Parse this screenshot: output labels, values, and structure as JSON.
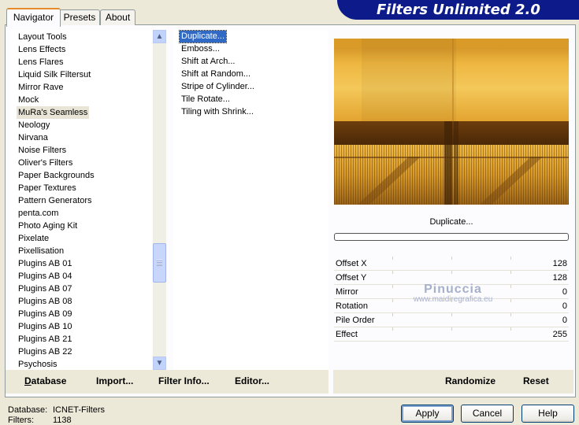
{
  "banner": {
    "title": "Filters Unlimited 2.0"
  },
  "tabs": [
    {
      "label": "Navigator",
      "active": true
    },
    {
      "label": "Presets",
      "active": false
    },
    {
      "label": "About",
      "active": false
    }
  ],
  "categories": [
    "Layout Tools",
    "Lens Effects",
    "Lens Flares",
    "Liquid Silk Filtersut",
    "Mirror Rave",
    "Mock",
    "MuRa's Seamless",
    "Neology",
    "Nirvana",
    "Noise Filters",
    "Oliver's Filters",
    "Paper Backgrounds",
    "Paper Textures",
    "Pattern Generators",
    "penta.com",
    "Photo Aging Kit",
    "Pixelate",
    "Pixellisation",
    "Plugins AB 01",
    "Plugins AB 04",
    "Plugins AB 07",
    "Plugins AB 08",
    "Plugins AB 09",
    "Plugins AB 10",
    "Plugins AB 21",
    "Plugins AB 22",
    "Psychosis"
  ],
  "selected_category": "MuRa's Seamless",
  "filters": [
    "Duplicate...",
    "Emboss...",
    "Shift at Arch...",
    "Shift at Random...",
    "Stripe of Cylinder...",
    "Tile Rotate...",
    "Tiling with Shrink..."
  ],
  "selected_filter": "Duplicate...",
  "current_filter_label": "Duplicate...",
  "progress": 0,
  "params": [
    {
      "label": "Offset X",
      "value": "128"
    },
    {
      "label": "Offset Y",
      "value": "128"
    },
    {
      "label": "Mirror",
      "value": "0"
    },
    {
      "label": "Rotation",
      "value": "0"
    },
    {
      "label": "Pile Order",
      "value": "0"
    },
    {
      "label": "Effect",
      "value": "255"
    }
  ],
  "watermark": {
    "name": "Pinuccia",
    "url": "www.maidiregrafica.eu"
  },
  "actions": {
    "database": "Database",
    "import": "Import...",
    "filter_info": "Filter Info...",
    "editor": "Editor...",
    "randomize": "Randomize",
    "reset": "Reset"
  },
  "status": {
    "database_label": "Database:",
    "database_value": "ICNET-Filters",
    "filters_label": "Filters:",
    "filters_value": "1138"
  },
  "buttons": {
    "apply": "Apply",
    "cancel": "Cancel",
    "help": "Help"
  },
  "colors": {
    "banner": "#0d1a8a",
    "selection": "#316ac5",
    "preview_gold": "#e0a832",
    "preview_brown": "#6a3c10"
  }
}
